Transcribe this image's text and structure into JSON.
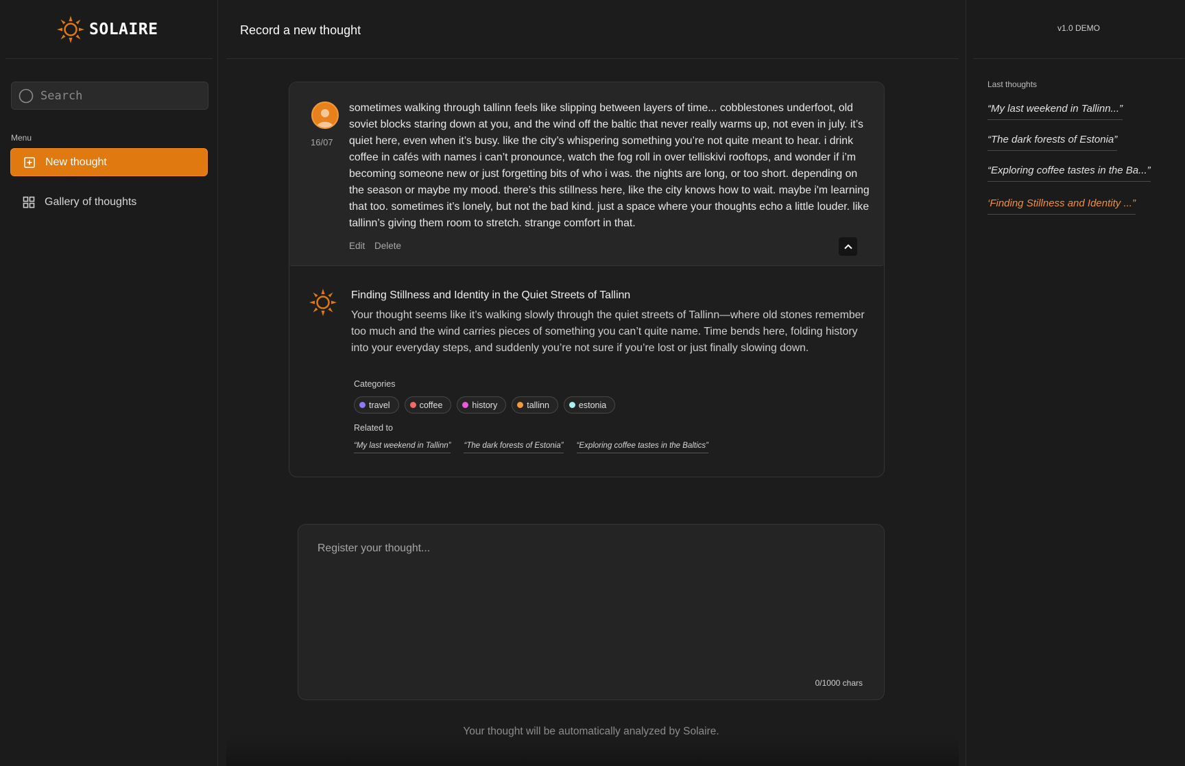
{
  "brand": {
    "name": "SOLAIRE",
    "accent": "#e07a10"
  },
  "sidebar": {
    "search_placeholder": "Search",
    "menu_label": "Menu",
    "items": [
      {
        "label": "New thought",
        "icon": "plus-square-icon",
        "active": true
      },
      {
        "label": "Gallery of thoughts",
        "icon": "grid-icon",
        "active": false
      }
    ]
  },
  "header": {
    "title": "Record a new thought"
  },
  "right": {
    "version": "v1.0 DEMO",
    "last_label": "Last thoughts",
    "items": [
      "“My last weekend in Tallinn...”",
      "“The dark forests of Estonia”",
      "“Exploring coffee tastes in the Ba...”",
      "‘Finding Stillness and Identity ...”"
    ]
  },
  "thought": {
    "date": "16/07",
    "text": "sometimes walking through tallinn feels like slipping between layers of time... cobblestones underfoot, old soviet blocks staring down at you, and the wind off the baltic that never really warms up, not even in july. it’s quiet here, even when it’s busy. like the city’s whispering something you’re not quite meant to hear. i drink coffee in cafés with names i can’t pronounce, watch the fog roll in over telliskivi rooftops, and wonder if i’m becoming someone new or just forgetting bits of who i was. the nights are long, or too short. depending on the season or maybe my mood. there’s this stillness here, like the city knows how to wait. maybe i'm learning that too. sometimes it’s lonely, but not the bad kind. just a space where your thoughts echo a little louder. like tallinn’s giving them room to stretch. strange comfort in that.",
    "edit_label": "Edit",
    "delete_label": "Delete"
  },
  "analysis": {
    "title": "Finding Stillness and Identity in the Quiet Streets of Tallinn",
    "text": "Your thought seems like it’s walking slowly through the quiet streets of Tallinn—where old stones remember too much and the wind carries pieces of something you can’t quite name. Time bends here, folding history into your everyday steps, and suddenly you’re not sure if you’re lost or just finally slowing down.",
    "categories_label": "Categories",
    "categories": [
      {
        "label": "travel",
        "color": "#8b7cf6"
      },
      {
        "label": "coffee",
        "color": "#f26a6a"
      },
      {
        "label": "history",
        "color": "#e85bd9"
      },
      {
        "label": "tallinn",
        "color": "#f39a3c"
      },
      {
        "label": "estonia",
        "color": "#a8f0f5"
      }
    ],
    "related_label": "Related to",
    "related": [
      "“My last weekend in Tallinn”",
      "“The dark forests of Estonia”",
      "“Exploring coffee tastes in the Baltics”"
    ]
  },
  "composer": {
    "placeholder": "Register your thought...",
    "counter": "0/1000 chars",
    "footnote": "Your thought will be automatically analyzed by Solaire."
  }
}
